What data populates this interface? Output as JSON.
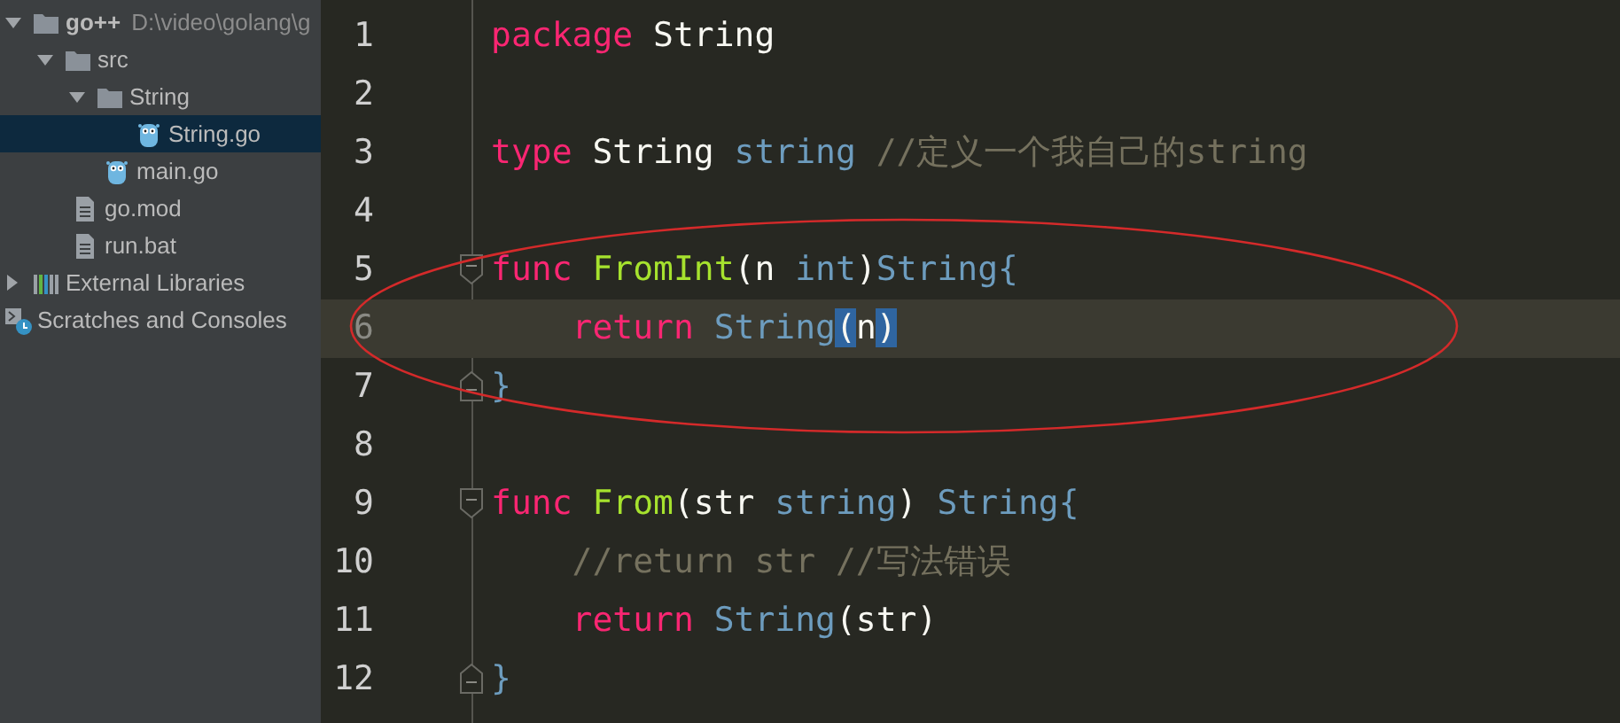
{
  "project_tree": [
    {
      "kind": "folder",
      "label": "go++",
      "path": "D:\\video\\golang\\g",
      "expanded": true,
      "selected": false,
      "children": [
        {
          "kind": "folder",
          "label": "src",
          "expanded": true,
          "selected": false,
          "children": [
            {
              "kind": "folder",
              "label": "String",
              "expanded": true,
              "selected": false,
              "children": [
                {
                  "kind": "go_file",
                  "label": "String.go",
                  "selected": true
                }
              ]
            },
            {
              "kind": "go_file",
              "label": "main.go",
              "selected": false
            }
          ]
        },
        {
          "kind": "text_file",
          "label": "go.mod",
          "selected": false
        },
        {
          "kind": "text_file",
          "label": "run.bat",
          "selected": false
        }
      ]
    },
    {
      "kind": "libraries",
      "label": "External Libraries",
      "expanded": false,
      "selected": false
    },
    {
      "kind": "scratches",
      "label": "Scratches and Consoles",
      "selected": false
    }
  ],
  "editor": {
    "lines": [
      {
        "number": "1",
        "current": false,
        "fold_start": false,
        "fold_end": false,
        "tokens": [
          {
            "kind": "keyword",
            "text": "package "
          },
          {
            "kind": "plain",
            "text": "String"
          }
        ]
      },
      {
        "number": "2",
        "current": false,
        "fold_start": false,
        "fold_end": false
      },
      {
        "number": "3",
        "current": false,
        "fold_start": false,
        "fold_end": false,
        "tokens": [
          {
            "kind": "keyword",
            "text": "type "
          },
          {
            "kind": "plain",
            "text": "String "
          },
          {
            "kind": "type",
            "text": "string "
          },
          {
            "kind": "comment",
            "text": "//定义一个我自己的string"
          }
        ]
      },
      {
        "number": "4",
        "current": false,
        "fold_start": false,
        "fold_end": false
      },
      {
        "number": "5",
        "current": false,
        "fold_start": true,
        "fold_end": false,
        "tokens": [
          {
            "kind": "keyword",
            "text": "func "
          },
          {
            "kind": "function",
            "text": "FromInt"
          },
          {
            "kind": "plain",
            "text": "(n "
          },
          {
            "kind": "type",
            "text": "int"
          },
          {
            "kind": "plain",
            "text": ")"
          },
          {
            "kind": "type",
            "text": "String{"
          }
        ]
      },
      {
        "number": "6",
        "current": true,
        "fold_start": false,
        "fold_end": false,
        "tokens": [
          {
            "kind": "keyword",
            "text": "    return "
          },
          {
            "kind": "type",
            "text": "String"
          },
          {
            "kind": "match",
            "text": "("
          },
          {
            "kind": "plain",
            "text": "n"
          },
          {
            "kind": "match",
            "text": ")"
          }
        ]
      },
      {
        "number": "7",
        "current": false,
        "fold_start": false,
        "fold_end": true,
        "tokens": [
          {
            "kind": "type",
            "text": "}"
          }
        ]
      },
      {
        "number": "8",
        "current": false,
        "fold_start": false,
        "fold_end": false
      },
      {
        "number": "9",
        "current": false,
        "fold_start": true,
        "fold_end": false,
        "tokens": [
          {
            "kind": "keyword",
            "text": "func "
          },
          {
            "kind": "function",
            "text": "From"
          },
          {
            "kind": "plain",
            "text": "(str "
          },
          {
            "kind": "type",
            "text": "string"
          },
          {
            "kind": "plain",
            "text": ") "
          },
          {
            "kind": "type",
            "text": "String{"
          }
        ]
      },
      {
        "number": "10",
        "current": false,
        "fold_start": false,
        "fold_end": false,
        "tokens": [
          {
            "kind": "comment",
            "text": "    //return str //写法错误"
          }
        ]
      },
      {
        "number": "11",
        "current": false,
        "fold_start": false,
        "fold_end": false,
        "tokens": [
          {
            "kind": "keyword",
            "text": "    return "
          },
          {
            "kind": "type",
            "text": "String"
          },
          {
            "kind": "plain",
            "text": "(str)"
          }
        ]
      },
      {
        "number": "12",
        "current": false,
        "fold_start": false,
        "fold_end": true,
        "tokens": [
          {
            "kind": "type",
            "text": "}"
          }
        ]
      }
    ]
  }
}
